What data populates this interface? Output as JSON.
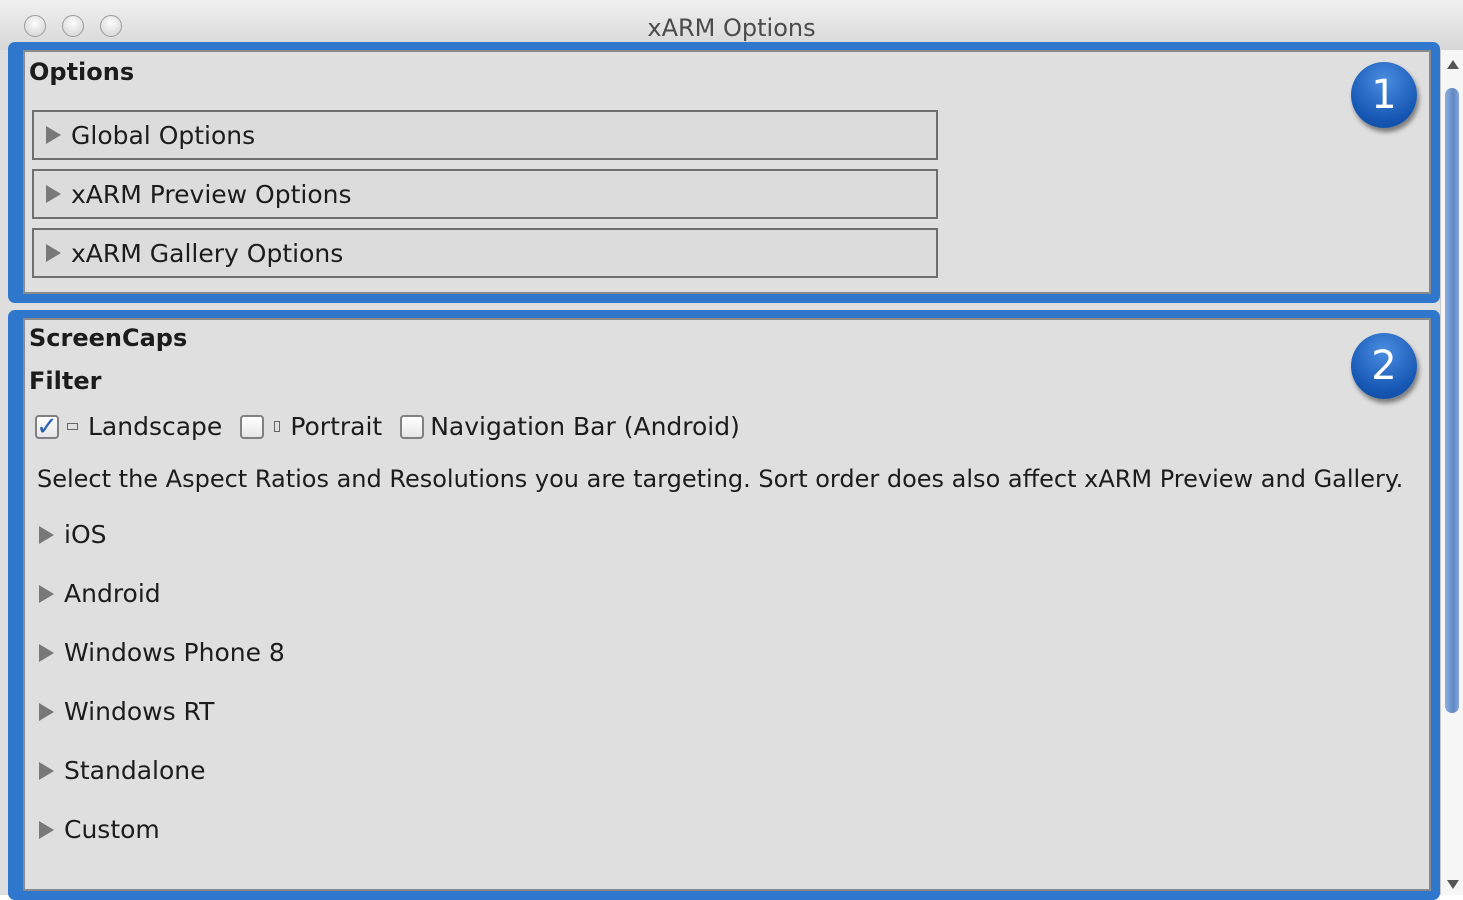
{
  "window": {
    "title": "xARM Options"
  },
  "options": {
    "title": "Options",
    "badge": "1",
    "foldouts": [
      "Global Options",
      "xARM Preview Options",
      "xARM Gallery Options"
    ]
  },
  "screencaps": {
    "title": "ScreenCaps",
    "badge": "2",
    "filter_label": "Filter",
    "filters": [
      {
        "label": "Landscape",
        "checked": true
      },
      {
        "label": "Portrait",
        "checked": false
      },
      {
        "label": "Navigation Bar (Android)",
        "checked": false
      }
    ],
    "description": "Select the Aspect Ratios and Resolutions you are targeting. Sort order does also affect xARM Preview and Gallery.",
    "platforms": [
      "iOS",
      "Android",
      "Windows Phone 8",
      "Windows RT",
      "Standalone",
      "Custom"
    ]
  },
  "colors": {
    "accent": "#2f77cc",
    "badge": "#1556b3",
    "panel_bg": "#dfdfdf"
  }
}
